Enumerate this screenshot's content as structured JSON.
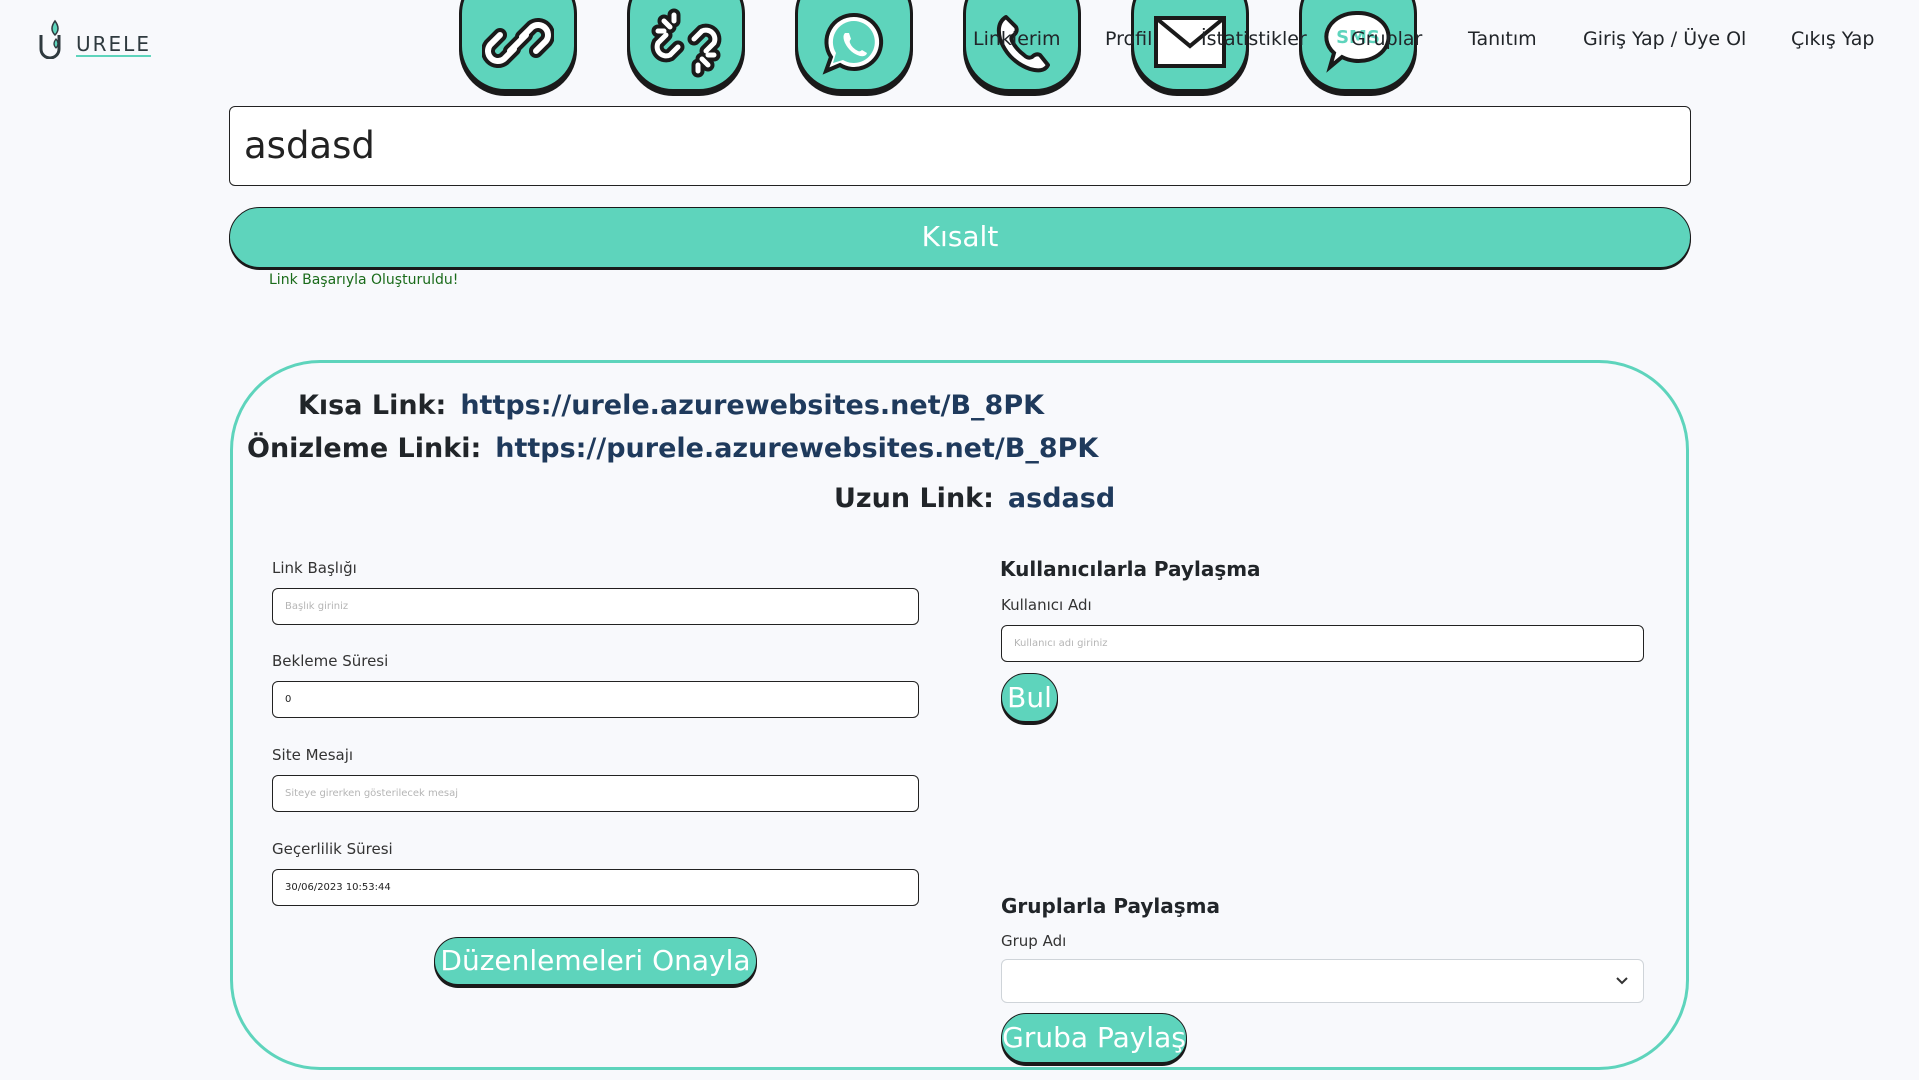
{
  "brand": {
    "name": "URELE"
  },
  "header": {
    "icon_buttons": [
      {
        "name": "link-icon"
      },
      {
        "name": "broken-link-icon"
      },
      {
        "name": "whatsapp-icon"
      },
      {
        "name": "phone-icon"
      },
      {
        "name": "mail-icon"
      },
      {
        "name": "sms-icon",
        "text": "SMS"
      }
    ],
    "nav": {
      "links": "Linklerim",
      "profile": "Profil",
      "stats": "İstatistikler",
      "groups": "Gruplar",
      "intro": "Tanıtım",
      "login": "Giriş Yap / Üye Ol",
      "logout": "Çıkış Yap"
    }
  },
  "shortener": {
    "input_value": "asdasd",
    "button_label": "Kısalt",
    "success_message": "Link Başarıyla Oluşturuldu!"
  },
  "result": {
    "short_link_label": "Kısa Link:",
    "short_link": "https://urele.azurewebsites.net/B_8PK",
    "preview_link_label": "Önizleme Linki:",
    "preview_link": "https://purele.azurewebsites.net/B_8PK",
    "long_link_label": "Uzun Link:",
    "long_link": "asdasd"
  },
  "edit_form": {
    "title_label": "Link Başlığı",
    "title_placeholder": "Başlık giriniz",
    "wait_label": "Bekleme Süresi",
    "wait_value": "0",
    "message_label": "Site Mesajı",
    "message_placeholder": "Siteye girerken gösterilecek mesaj",
    "validity_label": "Geçerlilik Süresi",
    "validity_value": "30/06/2023 10:53:44",
    "confirm_button": "Düzenlemeleri Onayla"
  },
  "user_share": {
    "title": "Kullanıcılarla Paylaşma",
    "username_label": "Kullanıcı Adı",
    "username_placeholder": "Kullanıcı adı giriniz",
    "find_button": "Bul"
  },
  "group_share": {
    "title": "Gruplarla Paylaşma",
    "group_label": "Grup Adı",
    "selected_group": "",
    "share_button": "Gruba Paylaş"
  },
  "colors": {
    "accent": "#5ed4bc",
    "link_text": "#1f3a5c",
    "success": "#1a6b1a",
    "background": "#f8f9fc"
  }
}
